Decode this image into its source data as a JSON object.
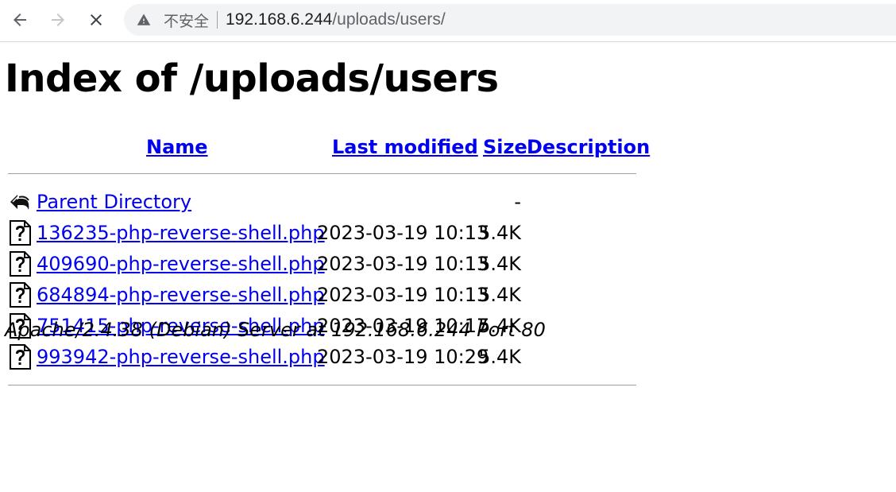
{
  "browser": {
    "security_label": "不安全",
    "url_host": "192.168.6.244",
    "url_path": "/uploads/users/"
  },
  "page": {
    "title": "Index of /uploads/users",
    "headers": {
      "name": "Name",
      "last_modified": "Last modified",
      "size": "Size",
      "description": "Description"
    },
    "parent": {
      "label": "Parent Directory",
      "size": "-",
      "icon": "back-icon"
    },
    "files": [
      {
        "name": "136235-php-reverse-shell.php",
        "modified": "2023-03-19 10:13",
        "size": "5.4K",
        "icon": "unknown-file-icon"
      },
      {
        "name": "409690-php-reverse-shell.php",
        "modified": "2023-03-19 10:13",
        "size": "5.4K",
        "icon": "unknown-file-icon"
      },
      {
        "name": "684894-php-reverse-shell.php",
        "modified": "2023-03-19 10:13",
        "size": "5.4K",
        "icon": "unknown-file-icon"
      },
      {
        "name": "751415-php-reverse-shell.php",
        "modified": "2023-03-19 10:17",
        "size": "5.4K",
        "icon": "unknown-file-icon"
      },
      {
        "name": "993942-php-reverse-shell.php",
        "modified": "2023-03-19 10:29",
        "size": "5.4K",
        "icon": "unknown-file-icon"
      }
    ],
    "footer": "Apache/2.4.38 (Debian) Server at 192.168.6.244 Port 80"
  },
  "colors": {
    "link": "#0000ee",
    "rule": "#a0a0a0"
  }
}
